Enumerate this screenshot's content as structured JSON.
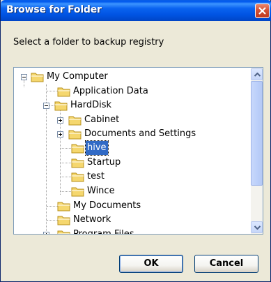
{
  "window": {
    "title": "Browse for Folder"
  },
  "prompt": "Select a folder to backup registry",
  "tree": {
    "items": [
      {
        "label": "My Computer"
      },
      {
        "label": "Application Data"
      },
      {
        "label": "HardDisk"
      },
      {
        "label": "Cabinet"
      },
      {
        "label": "Documents and Settings"
      },
      {
        "label": "hive",
        "selected": true
      },
      {
        "label": "Startup"
      },
      {
        "label": "test"
      },
      {
        "label": "Wince"
      },
      {
        "label": "My Documents"
      },
      {
        "label": "Network"
      },
      {
        "label": "Program Files"
      }
    ]
  },
  "buttons": {
    "ok": "OK",
    "cancel": "Cancel"
  },
  "colors": {
    "titlebar": "#0054e3",
    "selection": "#316ac5",
    "folder": "#f5d76e",
    "dialog_bg": "#ece9d8",
    "close": "#d45235"
  },
  "icons": {
    "folder": "folder-icon",
    "close": "close-icon",
    "expand": "expand-icon",
    "collapse": "collapse-icon",
    "scroll_up": "arrow-up-icon",
    "scroll_down": "arrow-down-icon"
  }
}
